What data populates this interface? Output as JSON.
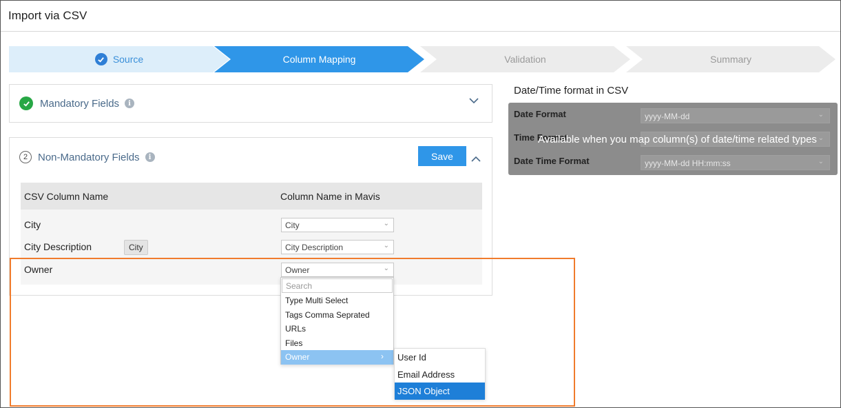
{
  "window": {
    "title": "Import via CSV"
  },
  "wizard": {
    "steps": [
      {
        "label": "Source",
        "state": "done"
      },
      {
        "label": "Column Mapping",
        "state": "active"
      },
      {
        "label": "Validation",
        "state": "pending"
      },
      {
        "label": "Summary",
        "state": "pending"
      }
    ]
  },
  "mandatory": {
    "title": "Mandatory Fields"
  },
  "non_mandatory": {
    "number": "2",
    "title": "Non-Mandatory Fields",
    "save_label": "Save",
    "headers": {
      "csv": "CSV Column Name",
      "mavis": "Column Name in Mavis"
    },
    "rows": [
      {
        "csv": "City",
        "mapped": "City"
      },
      {
        "csv": "City Description",
        "mapped": "City Description"
      },
      {
        "csv": "Owner",
        "mapped": "Owner"
      }
    ],
    "tooltip": "City"
  },
  "dropdown": {
    "search_placeholder": "Search",
    "items": [
      "Type Multi Select",
      "Tags Comma Seprated",
      "URLs",
      "Files",
      "Owner"
    ],
    "highlighted": "Owner"
  },
  "submenu": {
    "items": [
      "User Id",
      "Email Address",
      "JSON Object"
    ],
    "selected": "JSON Object"
  },
  "datetime": {
    "title": "Date/Time format in CSV",
    "fields": [
      {
        "label": "Date Format",
        "value": "yyyy-MM-dd"
      },
      {
        "label": "Time Format",
        "value": ""
      },
      {
        "label": "Date Time Format",
        "value": "yyyy-MM-dd HH:mm:ss"
      }
    ],
    "overlay_text": "Available when you map column(s) of date/time related types"
  },
  "colors": {
    "accent": "#2f96e8",
    "success": "#27a745",
    "highlight_frame": "#f07b2c",
    "selected_item": "#1e7fd8"
  }
}
